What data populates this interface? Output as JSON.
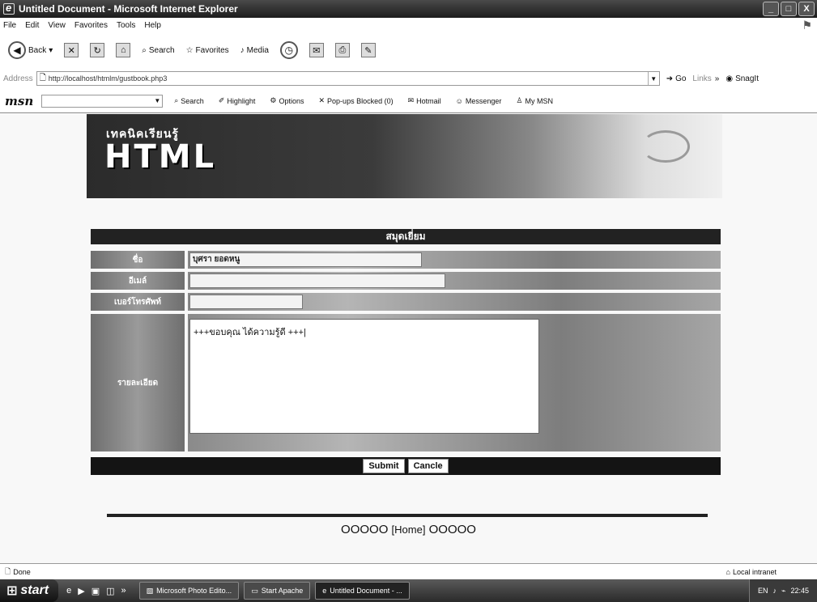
{
  "window": {
    "title": "Untitled Document - Microsoft Internet Explorer",
    "controls": [
      "_",
      "□",
      "X"
    ]
  },
  "menu": [
    "File",
    "Edit",
    "View",
    "Favorites",
    "Tools",
    "Help"
  ],
  "toolbar": {
    "back": "Back",
    "search": "Search",
    "favorites": "Favorites",
    "media": "Media"
  },
  "address": {
    "label": "Address",
    "url": "http://localhost/htmlm/gustbook.php3",
    "go": "Go",
    "links": "Links",
    "snagit": "SnagIt"
  },
  "msn": {
    "logo": "msn",
    "search": "Search",
    "highlight": "Highlight",
    "options": "Options",
    "popups": "Pop-ups Blocked (0)",
    "hotmail": "Hotmail",
    "messenger": "Messenger",
    "mymsn": "My MSN"
  },
  "page": {
    "banner_small": "เทคนิคเรียนรู้",
    "banner_big": "HTML",
    "form_title": "สมุดเยี่ยม",
    "fields": [
      {
        "label": "ชื่อ",
        "value": "บุศรา ยอดหนู"
      },
      {
        "label": "อีเมล์",
        "value": ""
      },
      {
        "label": "เบอร์โทรศัพท์",
        "value": ""
      },
      {
        "label": "รายละเอียด",
        "value": "+++ขอบคุณ ได้ความรู้ดี +++|"
      }
    ],
    "submit": "Submit",
    "cancel": "Cancle",
    "footer_left": "OOOOO",
    "footer_home": "[Home]",
    "footer_right": "OOOOO"
  },
  "status": {
    "text": "Done",
    "zone": "Local intranet"
  },
  "taskbar": {
    "start": "start",
    "tasks": [
      "Microsoft Photo Edito...",
      "Start Apache",
      "Untitled Document - ..."
    ],
    "lang": "EN",
    "clock": "22:45"
  }
}
